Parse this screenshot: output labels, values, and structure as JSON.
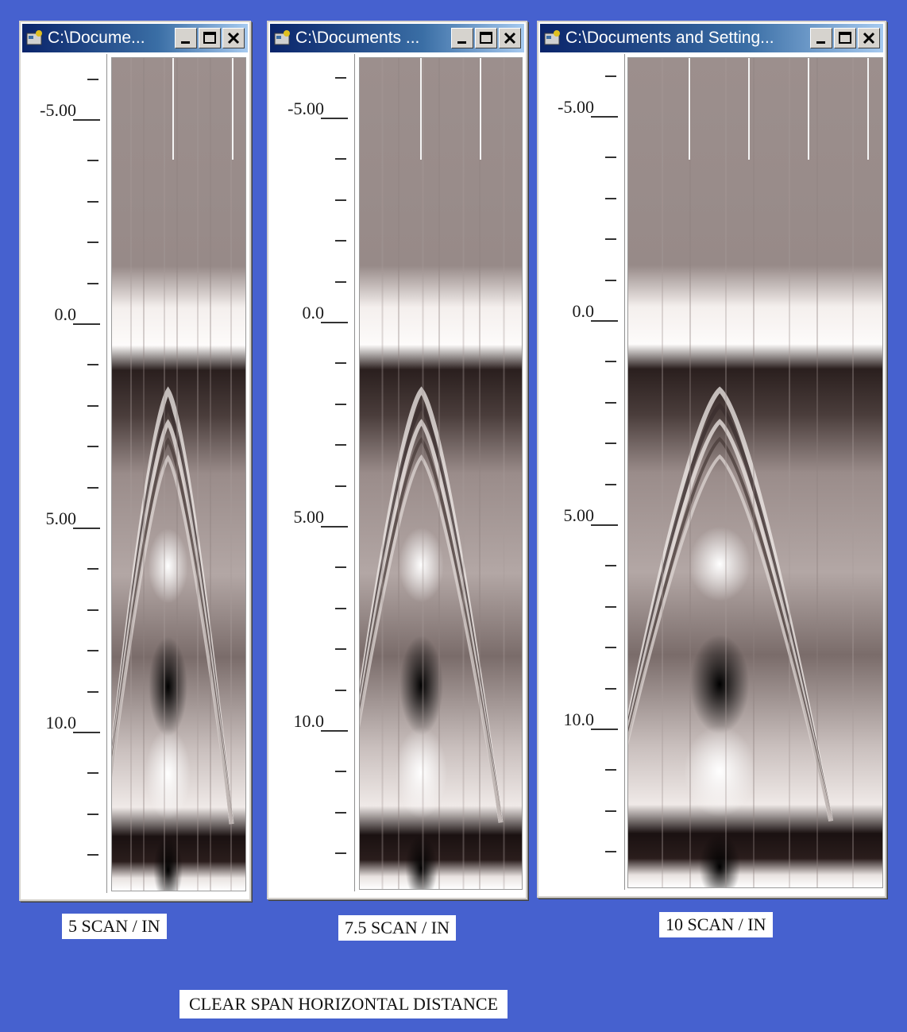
{
  "windows": [
    {
      "title": "C:\\Docume...",
      "label": "5 SCAN / IN"
    },
    {
      "title": "C:\\Documents ...",
      "label": "7.5 SCAN / IN"
    },
    {
      "title": "C:\\Documents and Setting...",
      "label": "10 SCAN / IN"
    }
  ],
  "axis": {
    "major_labels": [
      "-5.00",
      "0.0",
      "5.00",
      "10.0"
    ]
  },
  "caption": "CLEAR SPAN HORIZONTAL DISTANCE",
  "colors": {
    "background": "#4661cf",
    "titlebar": "#0a246a",
    "scan_base": "#9b8e8c"
  }
}
